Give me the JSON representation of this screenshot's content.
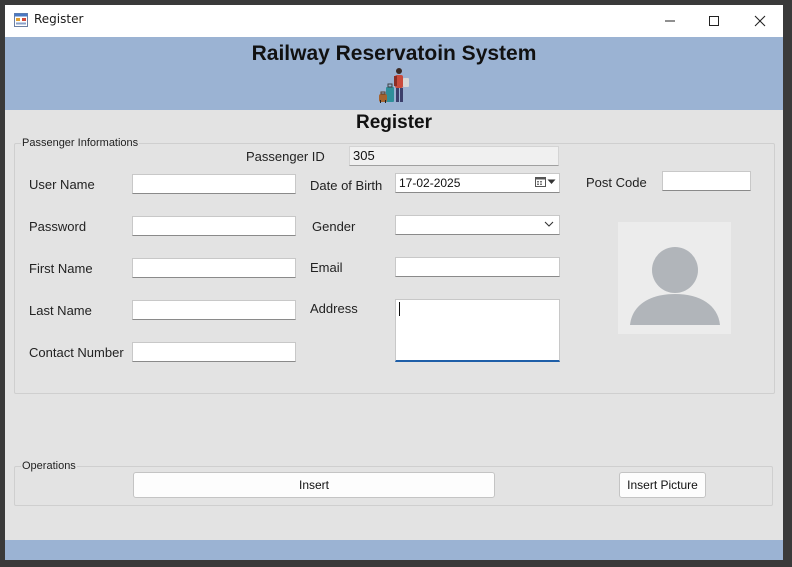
{
  "window": {
    "title": "Register",
    "icon": "form-app-icon",
    "controls": [
      "minimize-icon",
      "maximize-icon",
      "close-icon"
    ]
  },
  "header": {
    "system_title": "Railway Reservatoin System",
    "banner_icon": "traveler-luggage-icon",
    "page_heading": "Register"
  },
  "passenger_group": {
    "caption": "Passenger Informations",
    "passenger_id": {
      "label": "Passenger ID",
      "value": "305"
    },
    "user_name": {
      "label": "User Name",
      "value": ""
    },
    "password": {
      "label": "Password",
      "value": ""
    },
    "first_name": {
      "label": "First Name",
      "value": ""
    },
    "last_name": {
      "label": "Last Name",
      "value": ""
    },
    "contact_number": {
      "label": "Contact Number",
      "value": ""
    },
    "date_of_birth": {
      "label": "Date of Birth",
      "value": "17-02-2025"
    },
    "gender": {
      "label": "Gender",
      "value": ""
    },
    "email": {
      "label": "Email",
      "value": ""
    },
    "address": {
      "label": "Address",
      "value": ""
    },
    "post_code": {
      "label": "Post Code",
      "value": ""
    },
    "picture": "user-avatar-placeholder-icon"
  },
  "operations_group": {
    "caption": "Operations",
    "insert_label": "Insert",
    "insert_picture_label": "Insert Picture"
  },
  "colors": {
    "banner": "#9bb3d3",
    "window_bg": "#e3e3e3",
    "focus_accent": "#1f5fa8"
  }
}
